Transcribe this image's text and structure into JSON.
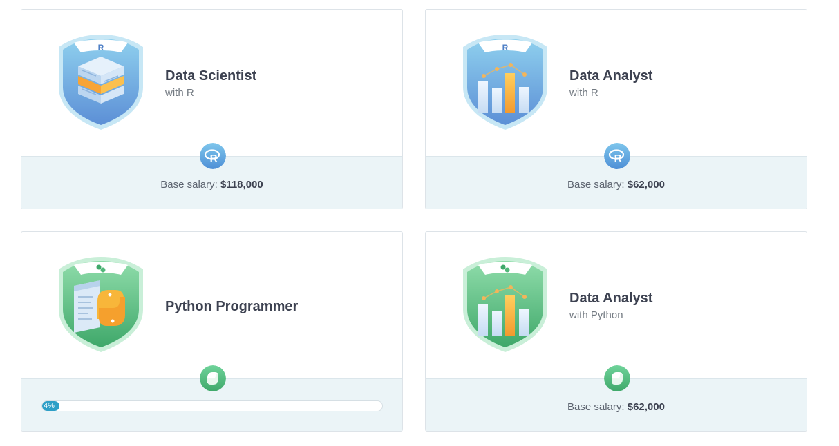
{
  "cards": [
    {
      "title": "Data Scientist",
      "subtitle": "with R",
      "technology": "R",
      "badge_color": "blue",
      "badge_icon": "server-stack-icon",
      "salary_label": "Base salary:",
      "salary_value": "$118,000"
    },
    {
      "title": "Data Analyst",
      "subtitle": "with R",
      "technology": "R",
      "badge_color": "blue",
      "badge_icon": "bar-chart-icon",
      "salary_label": "Base salary:",
      "salary_value": "$62,000"
    },
    {
      "title": "Python Programmer",
      "subtitle": "",
      "technology": "Python",
      "badge_color": "green",
      "badge_icon": "python-logo-icon",
      "progress_percent": 4,
      "progress_label": "4%"
    },
    {
      "title": "Data Analyst",
      "subtitle": "with Python",
      "technology": "Python",
      "badge_color": "green",
      "badge_icon": "bar-chart-icon",
      "salary_label": "Base salary:",
      "salary_value": "$62,000"
    }
  ],
  "colors": {
    "r_blue": "#5d9fd8",
    "python_green": "#52b87a",
    "footer_bg": "#ebf4f7",
    "progress_fill": "#2e9fc7",
    "title_text": "#3d4251"
  }
}
